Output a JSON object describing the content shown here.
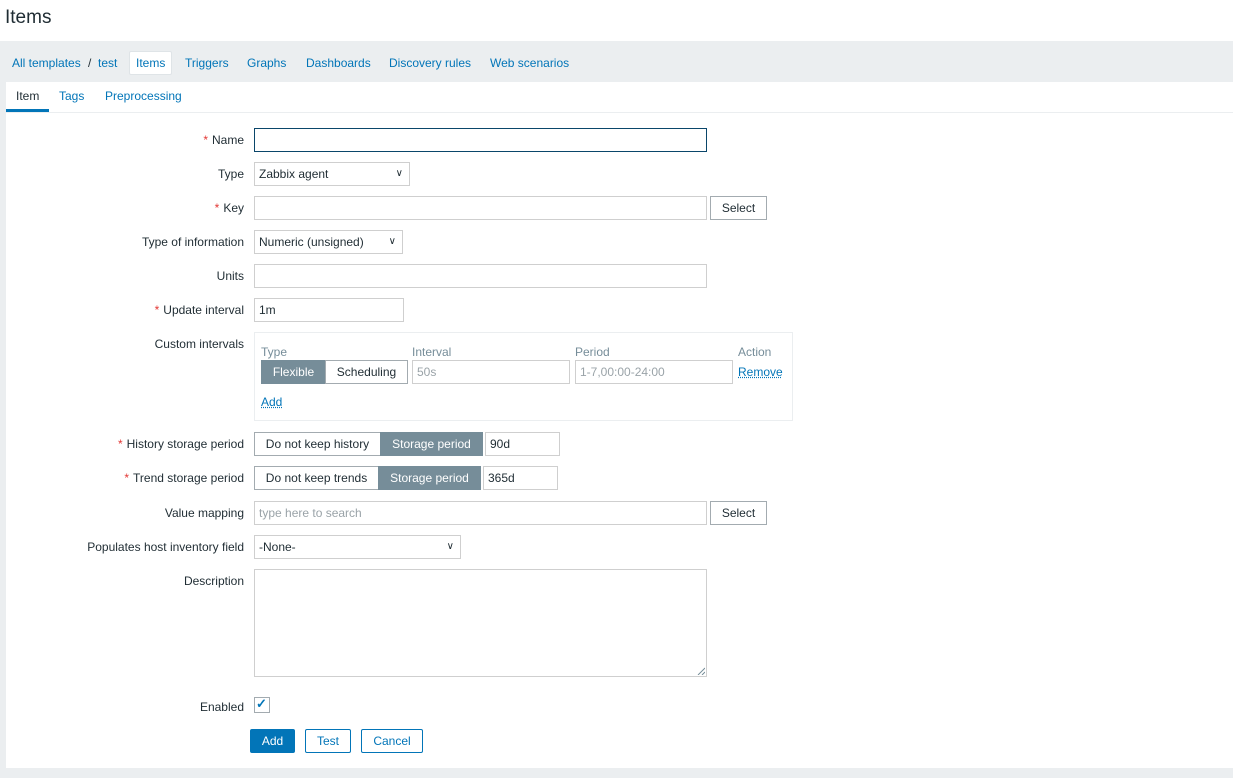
{
  "page": {
    "title": "Items"
  },
  "breadcrumbs": {
    "all_templates": "All templates",
    "separator": "/",
    "template": "test",
    "items": "Items",
    "triggers": "Triggers",
    "graphs": "Graphs",
    "dashboards": "Dashboards",
    "discovery_rules": "Discovery rules",
    "web_scenarios": "Web scenarios"
  },
  "tabs": {
    "item": "Item",
    "tags": "Tags",
    "preprocessing": "Preprocessing"
  },
  "form": {
    "name": {
      "label": "Name",
      "value": ""
    },
    "type": {
      "label": "Type",
      "value": "Zabbix agent"
    },
    "key": {
      "label": "Key",
      "value": "",
      "select": "Select"
    },
    "type_of_information": {
      "label": "Type of information",
      "value": "Numeric (unsigned)"
    },
    "units": {
      "label": "Units",
      "value": ""
    },
    "update_interval": {
      "label": "Update interval",
      "value": "1m"
    },
    "custom_intervals": {
      "label": "Custom intervals",
      "headers": {
        "type": "Type",
        "interval": "Interval",
        "period": "Period",
        "action": "Action"
      },
      "flexible": "Flexible",
      "scheduling": "Scheduling",
      "interval_placeholder": "50s",
      "period_placeholder": "1-7,00:00-24:00",
      "remove": "Remove",
      "add": "Add"
    },
    "history": {
      "label": "History storage period",
      "off": "Do not keep history",
      "on": "Storage period",
      "value": "90d"
    },
    "trends": {
      "label": "Trend storage period",
      "off": "Do not keep trends",
      "on": "Storage period",
      "value": "365d"
    },
    "value_mapping": {
      "label": "Value mapping",
      "placeholder": "type here to search",
      "select": "Select"
    },
    "inventory": {
      "label": "Populates host inventory field",
      "value": "-None-"
    },
    "description": {
      "label": "Description",
      "value": ""
    },
    "enabled": {
      "label": "Enabled",
      "checked": true
    }
  },
  "actions": {
    "add": "Add",
    "test": "Test",
    "cancel": "Cancel"
  },
  "colors": {
    "accent": "#0275b8",
    "required": "#e33734",
    "segment_active": "#768d99"
  }
}
